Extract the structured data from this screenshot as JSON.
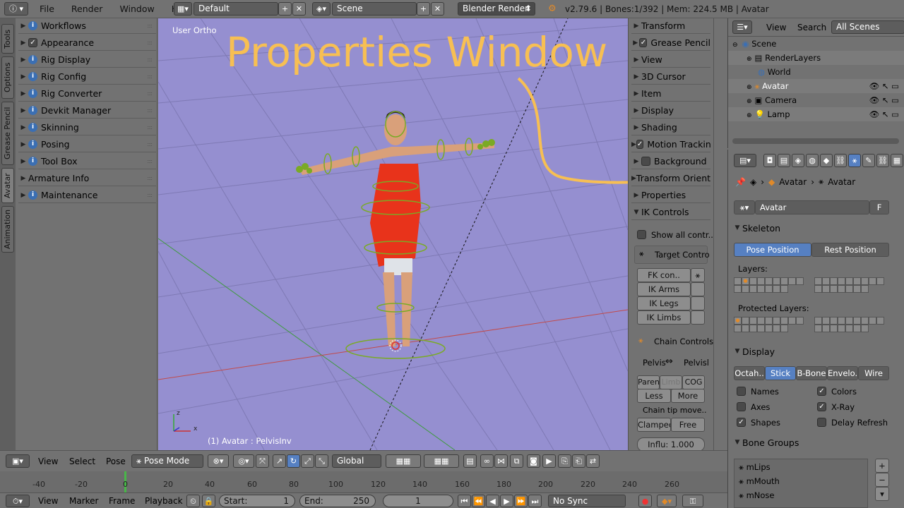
{
  "topbar": {
    "menus": [
      "File",
      "Render",
      "Window",
      "Help"
    ],
    "layout": "Default",
    "scene": "Scene",
    "engine": "Blender Render",
    "info": "v2.79.6 | Bones:1/392 | Mem: 224.5 MB | Avatar"
  },
  "vtabs": [
    "Tools",
    "Options",
    "Grease Pencil",
    "Avatar",
    "Animation"
  ],
  "toolshelf": [
    {
      "label": "Workflows",
      "icon": "info"
    },
    {
      "label": "Appearance",
      "icon": "check"
    },
    {
      "label": "Rig Display",
      "icon": "info"
    },
    {
      "label": "Rig Config",
      "icon": "info"
    },
    {
      "label": "Rig Converter",
      "icon": "info"
    },
    {
      "label": "Devkit Manager",
      "icon": "info"
    },
    {
      "label": "Skinning",
      "icon": "info"
    },
    {
      "label": "Posing",
      "icon": "info"
    },
    {
      "label": "Tool Box",
      "icon": "info"
    },
    {
      "label": "Armature Info",
      "icon": "none"
    },
    {
      "label": "Maintenance",
      "icon": "info"
    }
  ],
  "viewport": {
    "view_label": "User Ortho",
    "object_label": "(1) Avatar : PelvisInv",
    "overlay_title": "Properties Window",
    "overlay_color": "#f7bf53",
    "bg_color": "#958fd0"
  },
  "npanel": {
    "rows": [
      "Transform",
      "Grease Pencil",
      "View",
      "3D Cursor",
      "Item",
      "Display",
      "Shading",
      "Motion Tracking",
      "Background",
      "Transform Orientations",
      "Properties",
      "IK Controls"
    ],
    "show_all": "Show all contr..",
    "target_controls": "Target Contro",
    "fk_con": "FK con..",
    "ik_arms": "IK Arms",
    "ik_legs": "IK Legs",
    "ik_limbs": "IK Limbs",
    "chain_controls": "Chain Controls",
    "pelvis_a": "Pelvis",
    "pelvis_b": "Pelvisl",
    "paren": "Paren",
    "limb": "Limb",
    "cog": "COG",
    "less": "Less",
    "more": "More",
    "chain_tip": "Chain tip move..",
    "clamped": "Clamped",
    "free": "Free",
    "influence": "Influ: 1.000"
  },
  "outliner": {
    "view": "View",
    "search": "Search",
    "filter": "All Scenes",
    "items": [
      {
        "label": "Scene",
        "indent": 0
      },
      {
        "label": "RenderLayers",
        "indent": 1
      },
      {
        "label": "World",
        "indent": 1
      },
      {
        "label": "Avatar",
        "indent": 1,
        "highlight": true
      },
      {
        "label": "Camera",
        "indent": 1
      },
      {
        "label": "Lamp",
        "indent": 1
      }
    ]
  },
  "properties": {
    "breadcrumb_a": "Avatar",
    "breadcrumb_b": "Avatar",
    "data_name": "Avatar",
    "fake_user": "F",
    "skeleton": "Skeleton",
    "pose_position": "Pose Position",
    "rest_position": "Rest Position",
    "layers": "Layers:",
    "protected_layers": "Protected Layers:",
    "display": "Display",
    "display_modes": [
      "Octah..",
      "Stick",
      "B-Bone",
      "Envelo..",
      "Wire"
    ],
    "names": "Names",
    "colors": "Colors",
    "axes": "Axes",
    "xray": "X-Ray",
    "shapes": "Shapes",
    "delay_refresh": "Delay Refresh",
    "bone_groups": "Bone Groups",
    "groups": [
      "mLips",
      "mMouth",
      "mNose"
    ]
  },
  "header3d": {
    "view": "View",
    "select": "Select",
    "pose": "Pose",
    "mode": "Pose Mode",
    "orientation": "Global"
  },
  "timeline": {
    "ticks": [
      "-40",
      "-20",
      "0",
      "20",
      "40",
      "60",
      "80",
      "100",
      "120",
      "140",
      "160",
      "180",
      "200",
      "220",
      "240",
      "260"
    ]
  },
  "timehdr": {
    "view": "View",
    "marker": "Marker",
    "frame": "Frame",
    "playback": "Playback",
    "start_label": "Start:",
    "start": "1",
    "end_label": "End:",
    "end": "250",
    "current": "1",
    "sync": "No Sync"
  }
}
